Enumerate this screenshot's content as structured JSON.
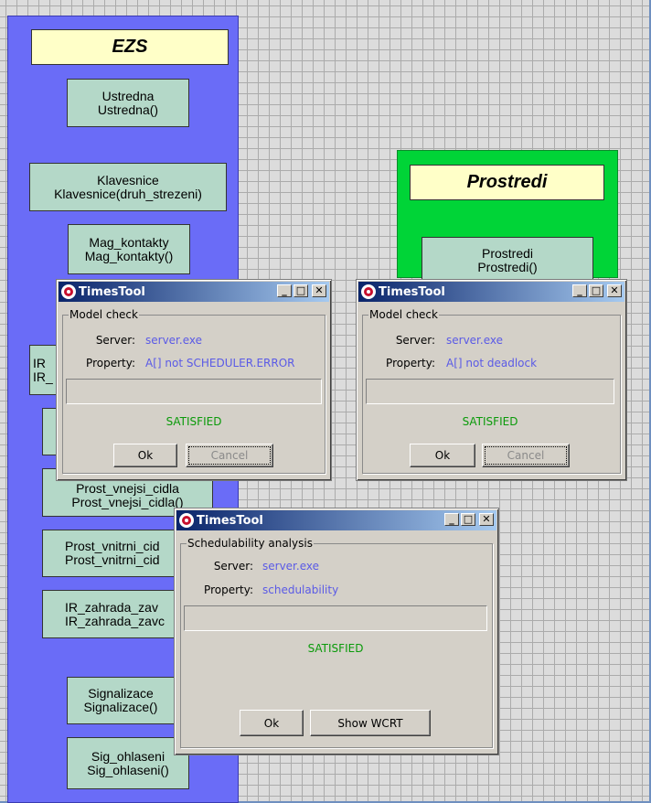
{
  "systems": [
    {
      "title": "EZS"
    },
    {
      "title": "Prostredi"
    }
  ],
  "processes": [
    {
      "name": "Ustredna",
      "call": "Ustredna()"
    },
    {
      "name": "Klavesnice",
      "call": "Klavesnice(druh_strezeni)"
    },
    {
      "name": "Mag_kontakty",
      "call": "Mag_kontakty()"
    },
    {
      "name": "IR",
      "call": "IR_"
    },
    {
      "name": "Prost_vnejsi_cidla",
      "call": "Prost_vnejsi_cidla()"
    },
    {
      "name": "Prost_vnitrni_cid",
      "call": "Prost_vnitrni_cid"
    },
    {
      "name": "IR_zahrada_zav",
      "call": "IR_zahrada_zavc"
    },
    {
      "name": "Signalizace",
      "call": "Signalizace()"
    },
    {
      "name": "Sig_ohlaseni",
      "call": "Sig_ohlaseni()"
    },
    {
      "name": "Prostredi",
      "call": "Prostredi()"
    }
  ],
  "dialogs": [
    {
      "title": "TimesTool",
      "group": "Model check",
      "server_label": "Server:",
      "server_value": "server.exe",
      "property_label": "Property:",
      "property_value": "A[] not SCHEDULER.ERROR",
      "status": "SATISFIED",
      "ok": "Ok",
      "cancel": "Cancel"
    },
    {
      "title": "TimesTool",
      "group": "Model check",
      "server_label": "Server:",
      "server_value": "server.exe",
      "property_label": "Property:",
      "property_value": "A[] not deadlock",
      "status": "SATISFIED",
      "ok": "Ok",
      "cancel": "Cancel"
    },
    {
      "title": "TimesTool",
      "group": "Schedulability analysis",
      "server_label": "Server:",
      "server_value": "server.exe",
      "property_label": "Property:",
      "property_value": "schedulability",
      "status": "SATISFIED",
      "ok": "Ok",
      "show_wcrt": "Show WCRT"
    }
  ],
  "window_buttons": {
    "minimize": "_",
    "maximize": "□",
    "close": "✕"
  },
  "colors": {
    "system_ezs": "#6a6cf7",
    "system_prostredi": "#00d437",
    "process_fill": "#b4d8c8",
    "status_green": "#0a9a0a",
    "value_blue": "#5a5ae6"
  }
}
